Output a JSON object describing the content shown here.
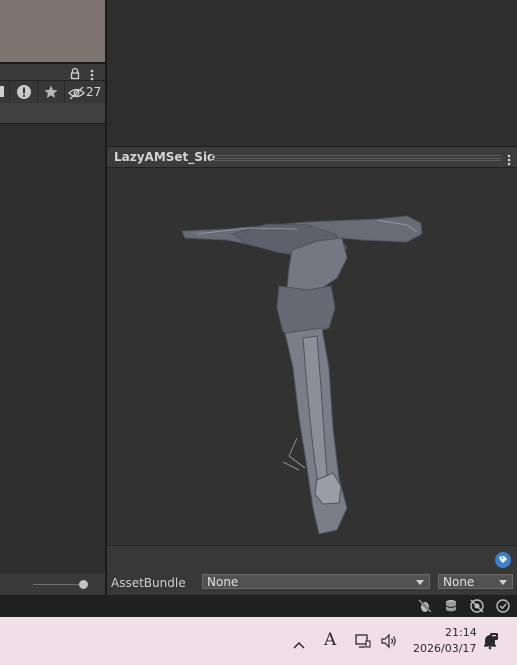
{
  "inspector": {
    "title": "LazyAMSet_Sio"
  },
  "left_toolbar": {
    "hidden_count": "27"
  },
  "asset_bundle": {
    "label": "AssetBundle",
    "name_value": "None",
    "variant_value": "None"
  },
  "clock": {
    "time": "21:14",
    "date": "2026/03/17"
  },
  "ime": {
    "mode": "A"
  },
  "colors": {
    "mesh": "#6b6f7a",
    "preview_bg": "#323232",
    "taskbar": "#f1dfe8",
    "tag_icon": "#3f7ec8"
  },
  "icons": {
    "left_header": [
      "lock-icon",
      "kebab-menu-icon"
    ],
    "left_toolbar": [
      "warning-icon",
      "star-icon",
      "eye-hidden-icon"
    ],
    "status_bar": [
      "debug-off-icon",
      "cache-icon",
      "network-off-icon",
      "check-circle-icon"
    ],
    "taskbar": [
      "chevron-up-icon",
      "ime-icon",
      "display-icon",
      "volume-icon",
      "notification-icon"
    ]
  }
}
